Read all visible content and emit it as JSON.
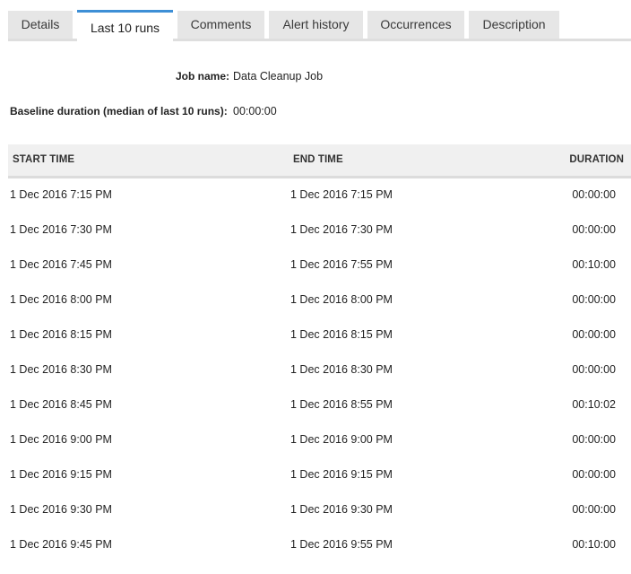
{
  "tabs": [
    {
      "label": "Details",
      "active": false
    },
    {
      "label": "Last 10 runs",
      "active": true
    },
    {
      "label": "Comments",
      "active": false
    },
    {
      "label": "Alert history",
      "active": false
    },
    {
      "label": "Occurrences",
      "active": false
    },
    {
      "label": "Description",
      "active": false
    }
  ],
  "colors": {
    "active_tab_accent": "#3d8fd6",
    "tab_background": "#e6e6e6",
    "header_background": "#f0f0f0"
  },
  "job": {
    "name_label": "Job name:",
    "name_value": "Data Cleanup Job",
    "baseline_label": "Baseline duration (median of last 10 runs):",
    "baseline_value": "00:00:00"
  },
  "table": {
    "columns": [
      "START TIME",
      "END TIME",
      "DURATION"
    ],
    "rows": [
      {
        "start": "1 Dec 2016 7:15 PM",
        "end": "1 Dec 2016 7:15 PM",
        "duration": "00:00:00"
      },
      {
        "start": "1 Dec 2016 7:30 PM",
        "end": "1 Dec 2016 7:30 PM",
        "duration": "00:00:00"
      },
      {
        "start": "1 Dec 2016 7:45 PM",
        "end": "1 Dec 2016 7:55 PM",
        "duration": "00:10:00"
      },
      {
        "start": "1 Dec 2016 8:00 PM",
        "end": "1 Dec 2016 8:00 PM",
        "duration": "00:00:00"
      },
      {
        "start": "1 Dec 2016 8:15 PM",
        "end": "1 Dec 2016 8:15 PM",
        "duration": "00:00:00"
      },
      {
        "start": "1 Dec 2016 8:30 PM",
        "end": "1 Dec 2016 8:30 PM",
        "duration": "00:00:00"
      },
      {
        "start": "1 Dec 2016 8:45 PM",
        "end": "1 Dec 2016 8:55 PM",
        "duration": "00:10:02"
      },
      {
        "start": "1 Dec 2016 9:00 PM",
        "end": "1 Dec 2016 9:00 PM",
        "duration": "00:00:00"
      },
      {
        "start": "1 Dec 2016 9:15 PM",
        "end": "1 Dec 2016 9:15 PM",
        "duration": "00:00:00"
      },
      {
        "start": "1 Dec 2016 9:30 PM",
        "end": "1 Dec 2016 9:30 PM",
        "duration": "00:00:00"
      },
      {
        "start": "1 Dec 2016 9:45 PM",
        "end": "1 Dec 2016 9:55 PM",
        "duration": "00:10:00"
      }
    ]
  }
}
